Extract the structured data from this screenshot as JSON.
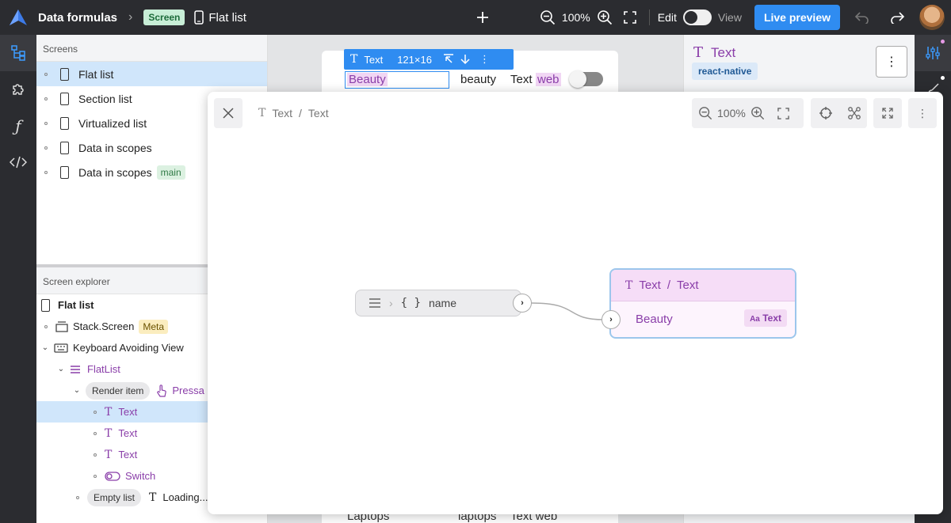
{
  "topbar": {
    "app_title": "Data formulas",
    "crumb_sep": ">",
    "screen_badge": "Screen",
    "screen_name": "Flat list",
    "zoom": "100%",
    "edit_label": "Edit",
    "view_label": "View",
    "live_preview_label": "Live preview"
  },
  "screens_panel": {
    "title": "Screens",
    "items": [
      {
        "label": "Flat list"
      },
      {
        "label": "Section list"
      },
      {
        "label": "Virtualized list"
      },
      {
        "label": "Data in scopes"
      },
      {
        "label": "Data in scopes",
        "tag": "main"
      }
    ]
  },
  "explorer": {
    "title": "Screen explorer",
    "root": "Flat list",
    "stack_screen": "Stack.Screen",
    "meta_tag": "Meta",
    "kav": "Keyboard Avoiding View",
    "flatlist": "FlatList",
    "render_item": "Render item",
    "pressable": "Pressa",
    "text_1": "Text",
    "text_2": "Text",
    "text_3": "Text",
    "switch": "Switch",
    "empty_list": "Empty list",
    "loading": "Loading..."
  },
  "canvas": {
    "toolbar_label": "Text",
    "toolbar_size": "121×16",
    "row_beauty_1": "Beauty",
    "row_beauty_2": "beauty",
    "row_text": "Text",
    "row_web": "web",
    "bottom_1": "Laptops",
    "bottom_2": "laptops",
    "bottom_3": "Text web"
  },
  "right_panel": {
    "title": "Text",
    "tag": "react-native",
    "more": "⋮"
  },
  "modal": {
    "crumb_1": "Text",
    "crumb_sep": "/",
    "crumb_2": "Text",
    "zoom": "100%",
    "source_node_label": "name",
    "target_header_1": "Text",
    "target_header_sep": "/",
    "target_header_2": "Text",
    "target_value": "Beauty",
    "target_chip_prefix": "Aa",
    "target_chip": "Text"
  },
  "colors": {
    "accent": "#2f8cf1",
    "purple": "#8a3ea9",
    "dark_bg": "#2b2c30"
  }
}
